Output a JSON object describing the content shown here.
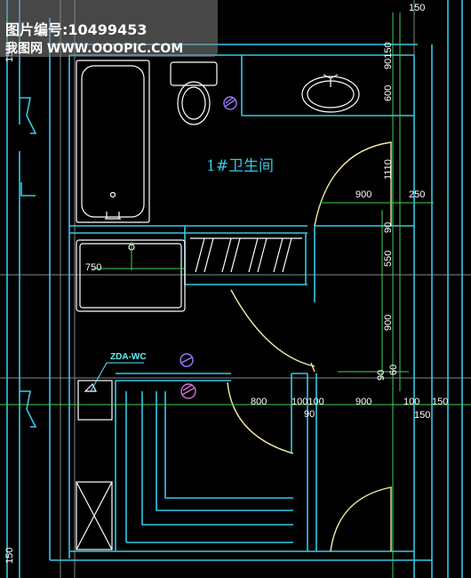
{
  "watermark": {
    "line1": "图片编号:10499453",
    "line2": "我图网 WWW.OOOPIC.COM"
  },
  "room_label": "1#卫生间",
  "fixture_tag": "ZDA-WC",
  "dimensions": {
    "top_150": "150",
    "v_90150": "90150",
    "v_600": "600",
    "v_1110": "1110",
    "h_900": "900",
    "h_250": "250",
    "v_90a": "90",
    "v_550": "550",
    "h_750": "750",
    "v_900": "900",
    "v_90b": "90",
    "v_60": "60",
    "h_800": "800",
    "h_100100": "100100",
    "h_90": "90",
    "h_900b": "900",
    "h_100": "100",
    "h_150a": "150",
    "h_150b": "150",
    "left_150": "150",
    "left_150b": "150"
  },
  "colors": {
    "wall": "#35c9e8",
    "fixture": "#ffffff",
    "door": "#f2e9a6",
    "grid": "#7e8c8c",
    "dim_line": "#41d25a"
  }
}
